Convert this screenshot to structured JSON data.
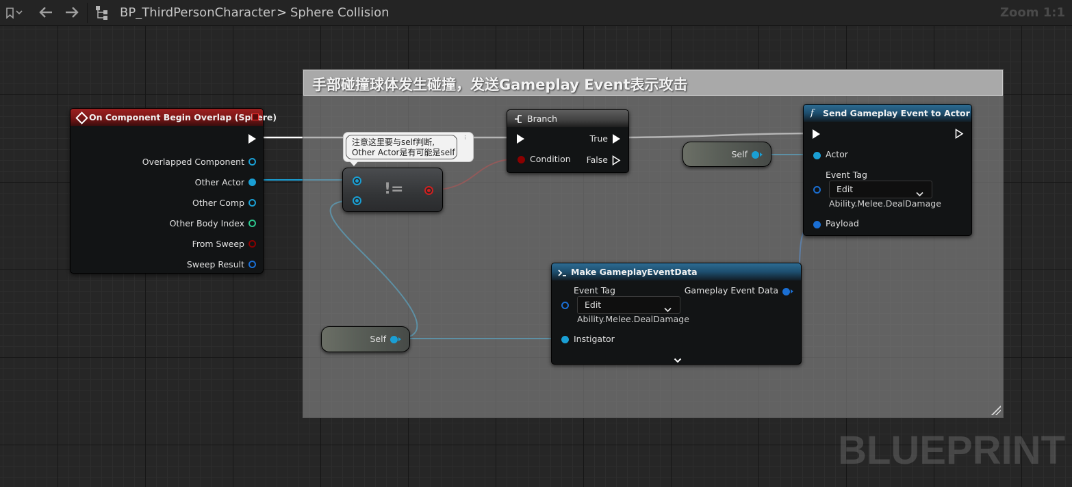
{
  "toolbar": {
    "bookmark_icon": "bookmark-icon",
    "back_icon": "arrow-left-icon",
    "forward_icon": "arrow-right-icon",
    "hierarchy_icon": "hierarchy-icon",
    "breadcrumb_root": "BP_ThirdPersonCharacter",
    "breadcrumb_sep": ">",
    "breadcrumb_current": "Sphere Collision",
    "zoom": "Zoom 1:1"
  },
  "comment": {
    "title": "手部碰撞球体发生碰撞，发送Gameplay Event表示攻击"
  },
  "event_node": {
    "title": "On Component Begin Overlap (Sphere)",
    "pins": [
      {
        "label": "Overlapped Component",
        "color": "#1a9fd4"
      },
      {
        "label": "Other Actor",
        "color": "#1a9fd4"
      },
      {
        "label": "Other Comp",
        "color": "#1a9fd4"
      },
      {
        "label": "Other Body Index",
        "color": "#2cc78e"
      },
      {
        "label": "From Sweep",
        "color": "#8b0000"
      },
      {
        "label": "Sweep Result",
        "color": "#1a6fd4"
      }
    ]
  },
  "tooltip": {
    "line1": "注意这里要与self判断,",
    "line2": "Other Actor是有可能是self"
  },
  "not_equal_node": {
    "symbol": "!="
  },
  "branch_node": {
    "title": "Branch",
    "true_label": "True",
    "condition_label": "Condition",
    "false_label": "False"
  },
  "self_node_top": {
    "label": "Self"
  },
  "self_node_bottom": {
    "label": "Self"
  },
  "send_node": {
    "title": "Send Gameplay Event to Actor",
    "actor_label": "Actor",
    "event_tag_label": "Event Tag",
    "dropdown_value": "Edit",
    "tag_value": "Ability.Melee.DealDamage",
    "payload_label": "Payload"
  },
  "make_node": {
    "title": "Make GameplayEventData",
    "event_tag_label": "Event Tag",
    "dropdown_value": "Edit",
    "tag_value": "Ability.Melee.DealDamage",
    "output_label": "Gameplay Event Data",
    "instigator_label": "Instigator"
  },
  "watermark": "BLUEPRINT",
  "colors": {
    "exec": "#ffffff",
    "object_pin": "#1a9fd4",
    "bool_pin": "#8b0000",
    "struct_pin": "#1a6fd4",
    "event_header": "#8c1a1a",
    "function_header": "#1d4e6e"
  }
}
